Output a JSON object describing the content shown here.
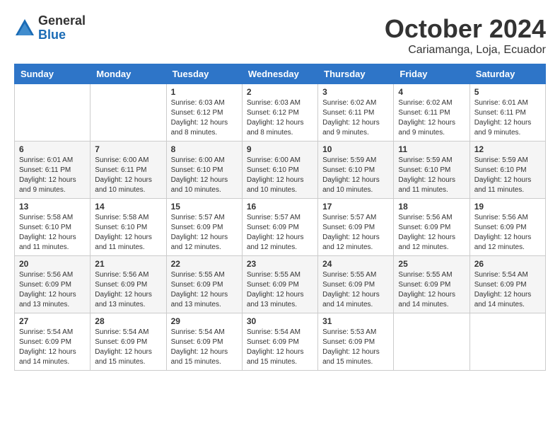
{
  "logo": {
    "general": "General",
    "blue": "Blue"
  },
  "title": "October 2024",
  "location": "Cariamanga, Loja, Ecuador",
  "headers": [
    "Sunday",
    "Monday",
    "Tuesday",
    "Wednesday",
    "Thursday",
    "Friday",
    "Saturday"
  ],
  "weeks": [
    [
      {
        "day": "",
        "info": ""
      },
      {
        "day": "",
        "info": ""
      },
      {
        "day": "1",
        "info": "Sunrise: 6:03 AM\nSunset: 6:12 PM\nDaylight: 12 hours and 8 minutes."
      },
      {
        "day": "2",
        "info": "Sunrise: 6:03 AM\nSunset: 6:12 PM\nDaylight: 12 hours and 8 minutes."
      },
      {
        "day": "3",
        "info": "Sunrise: 6:02 AM\nSunset: 6:11 PM\nDaylight: 12 hours and 9 minutes."
      },
      {
        "day": "4",
        "info": "Sunrise: 6:02 AM\nSunset: 6:11 PM\nDaylight: 12 hours and 9 minutes."
      },
      {
        "day": "5",
        "info": "Sunrise: 6:01 AM\nSunset: 6:11 PM\nDaylight: 12 hours and 9 minutes."
      }
    ],
    [
      {
        "day": "6",
        "info": "Sunrise: 6:01 AM\nSunset: 6:11 PM\nDaylight: 12 hours and 9 minutes."
      },
      {
        "day": "7",
        "info": "Sunrise: 6:00 AM\nSunset: 6:11 PM\nDaylight: 12 hours and 10 minutes."
      },
      {
        "day": "8",
        "info": "Sunrise: 6:00 AM\nSunset: 6:10 PM\nDaylight: 12 hours and 10 minutes."
      },
      {
        "day": "9",
        "info": "Sunrise: 6:00 AM\nSunset: 6:10 PM\nDaylight: 12 hours and 10 minutes."
      },
      {
        "day": "10",
        "info": "Sunrise: 5:59 AM\nSunset: 6:10 PM\nDaylight: 12 hours and 10 minutes."
      },
      {
        "day": "11",
        "info": "Sunrise: 5:59 AM\nSunset: 6:10 PM\nDaylight: 12 hours and 11 minutes."
      },
      {
        "day": "12",
        "info": "Sunrise: 5:59 AM\nSunset: 6:10 PM\nDaylight: 12 hours and 11 minutes."
      }
    ],
    [
      {
        "day": "13",
        "info": "Sunrise: 5:58 AM\nSunset: 6:10 PM\nDaylight: 12 hours and 11 minutes."
      },
      {
        "day": "14",
        "info": "Sunrise: 5:58 AM\nSunset: 6:10 PM\nDaylight: 12 hours and 11 minutes."
      },
      {
        "day": "15",
        "info": "Sunrise: 5:57 AM\nSunset: 6:09 PM\nDaylight: 12 hours and 12 minutes."
      },
      {
        "day": "16",
        "info": "Sunrise: 5:57 AM\nSunset: 6:09 PM\nDaylight: 12 hours and 12 minutes."
      },
      {
        "day": "17",
        "info": "Sunrise: 5:57 AM\nSunset: 6:09 PM\nDaylight: 12 hours and 12 minutes."
      },
      {
        "day": "18",
        "info": "Sunrise: 5:56 AM\nSunset: 6:09 PM\nDaylight: 12 hours and 12 minutes."
      },
      {
        "day": "19",
        "info": "Sunrise: 5:56 AM\nSunset: 6:09 PM\nDaylight: 12 hours and 12 minutes."
      }
    ],
    [
      {
        "day": "20",
        "info": "Sunrise: 5:56 AM\nSunset: 6:09 PM\nDaylight: 12 hours and 13 minutes."
      },
      {
        "day": "21",
        "info": "Sunrise: 5:56 AM\nSunset: 6:09 PM\nDaylight: 12 hours and 13 minutes."
      },
      {
        "day": "22",
        "info": "Sunrise: 5:55 AM\nSunset: 6:09 PM\nDaylight: 12 hours and 13 minutes."
      },
      {
        "day": "23",
        "info": "Sunrise: 5:55 AM\nSunset: 6:09 PM\nDaylight: 12 hours and 13 minutes."
      },
      {
        "day": "24",
        "info": "Sunrise: 5:55 AM\nSunset: 6:09 PM\nDaylight: 12 hours and 14 minutes."
      },
      {
        "day": "25",
        "info": "Sunrise: 5:55 AM\nSunset: 6:09 PM\nDaylight: 12 hours and 14 minutes."
      },
      {
        "day": "26",
        "info": "Sunrise: 5:54 AM\nSunset: 6:09 PM\nDaylight: 12 hours and 14 minutes."
      }
    ],
    [
      {
        "day": "27",
        "info": "Sunrise: 5:54 AM\nSunset: 6:09 PM\nDaylight: 12 hours and 14 minutes."
      },
      {
        "day": "28",
        "info": "Sunrise: 5:54 AM\nSunset: 6:09 PM\nDaylight: 12 hours and 15 minutes."
      },
      {
        "day": "29",
        "info": "Sunrise: 5:54 AM\nSunset: 6:09 PM\nDaylight: 12 hours and 15 minutes."
      },
      {
        "day": "30",
        "info": "Sunrise: 5:54 AM\nSunset: 6:09 PM\nDaylight: 12 hours and 15 minutes."
      },
      {
        "day": "31",
        "info": "Sunrise: 5:53 AM\nSunset: 6:09 PM\nDaylight: 12 hours and 15 minutes."
      },
      {
        "day": "",
        "info": ""
      },
      {
        "day": "",
        "info": ""
      }
    ]
  ]
}
